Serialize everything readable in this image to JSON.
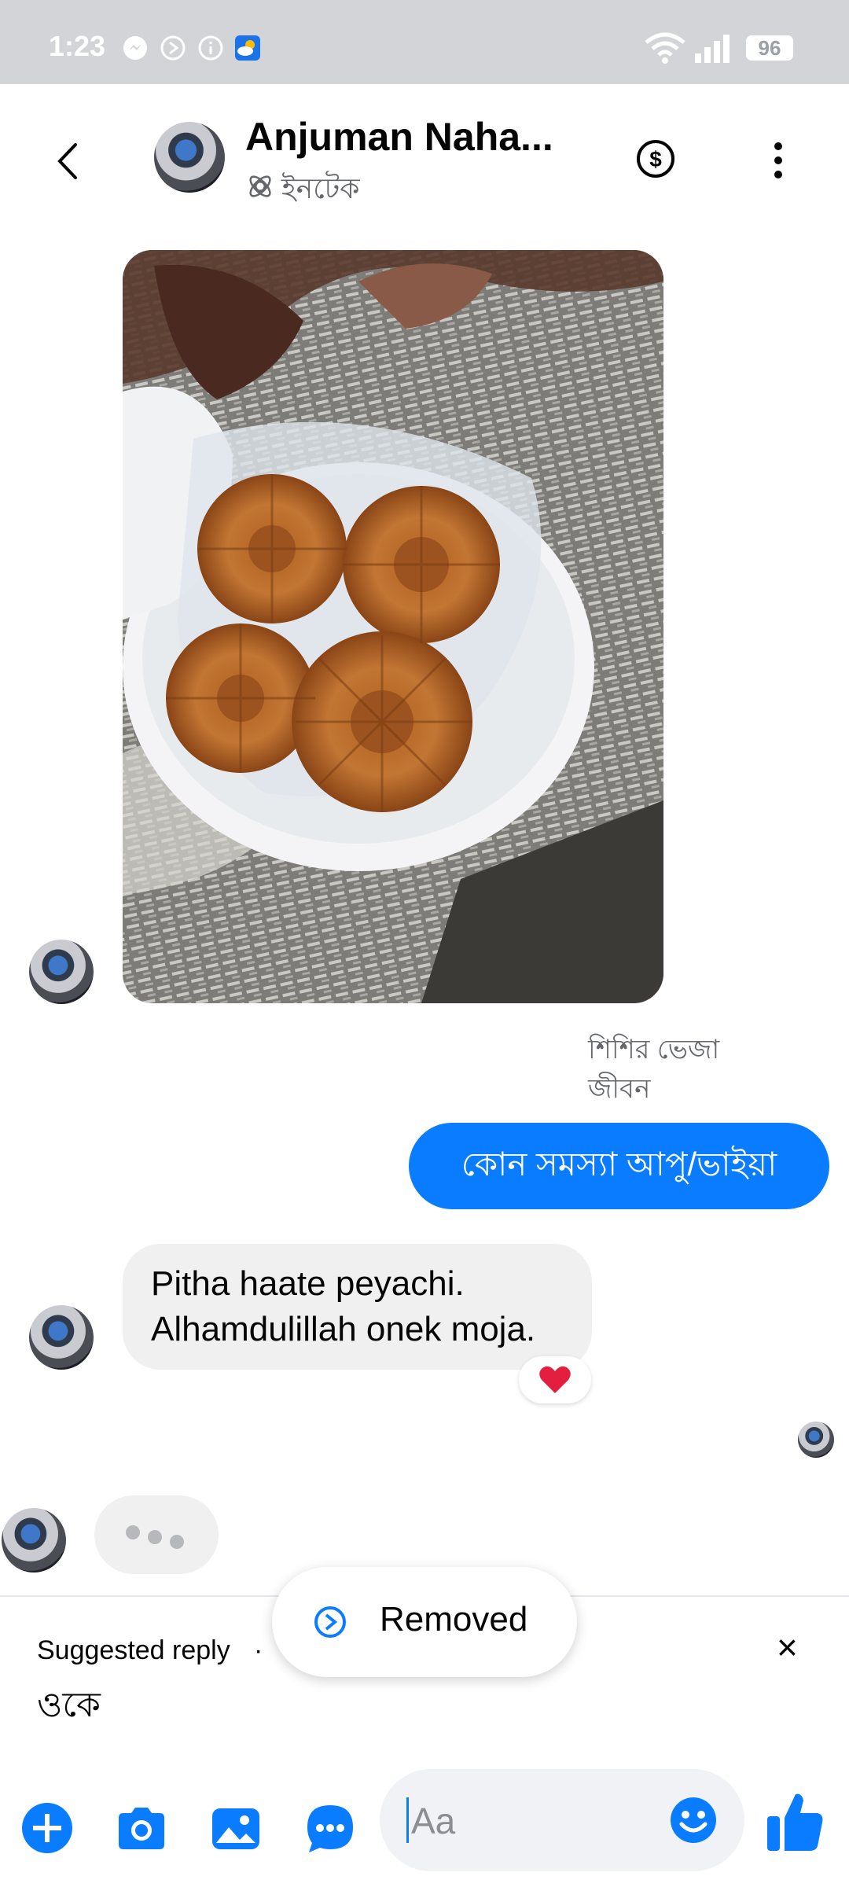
{
  "status_bar": {
    "time": "1:23",
    "battery": "96"
  },
  "header": {
    "contact_name": "Anjuman Naha...",
    "subtitle": "ইনটেক"
  },
  "messages": {
    "caption": [
      "শিশির ভেজা",
      "জীবন"
    ],
    "sent_text": "কোন সমস্যা আপু/ভাইয়া",
    "received_line1": "Pitha haate peyachi.",
    "received_line2": "Alhamdulillah onek moja.",
    "reaction": "heart"
  },
  "suggestion": {
    "label": "Suggested reply",
    "dot": "·",
    "reply": "ওকে",
    "close": "×"
  },
  "toast": {
    "text": "Removed"
  },
  "composer": {
    "placeholder": "Aa"
  },
  "colors": {
    "accent": "#0a7cff",
    "bubble_gray": "#f0f0f0",
    "heart": "#e41e3f"
  },
  "icons": {
    "status": [
      "messenger-icon",
      "block-icon",
      "info-icon",
      "weather-icon",
      "wifi-icon",
      "signal-icon"
    ],
    "header": [
      "back-arrow-icon",
      "dollar-icon",
      "more-vertical-icon",
      "bubble-theme-icon"
    ],
    "bottom": [
      "plus-icon",
      "camera-icon",
      "gallery-icon",
      "chat-apps-icon",
      "emoji-icon",
      "thumbs-up-icon"
    ]
  }
}
